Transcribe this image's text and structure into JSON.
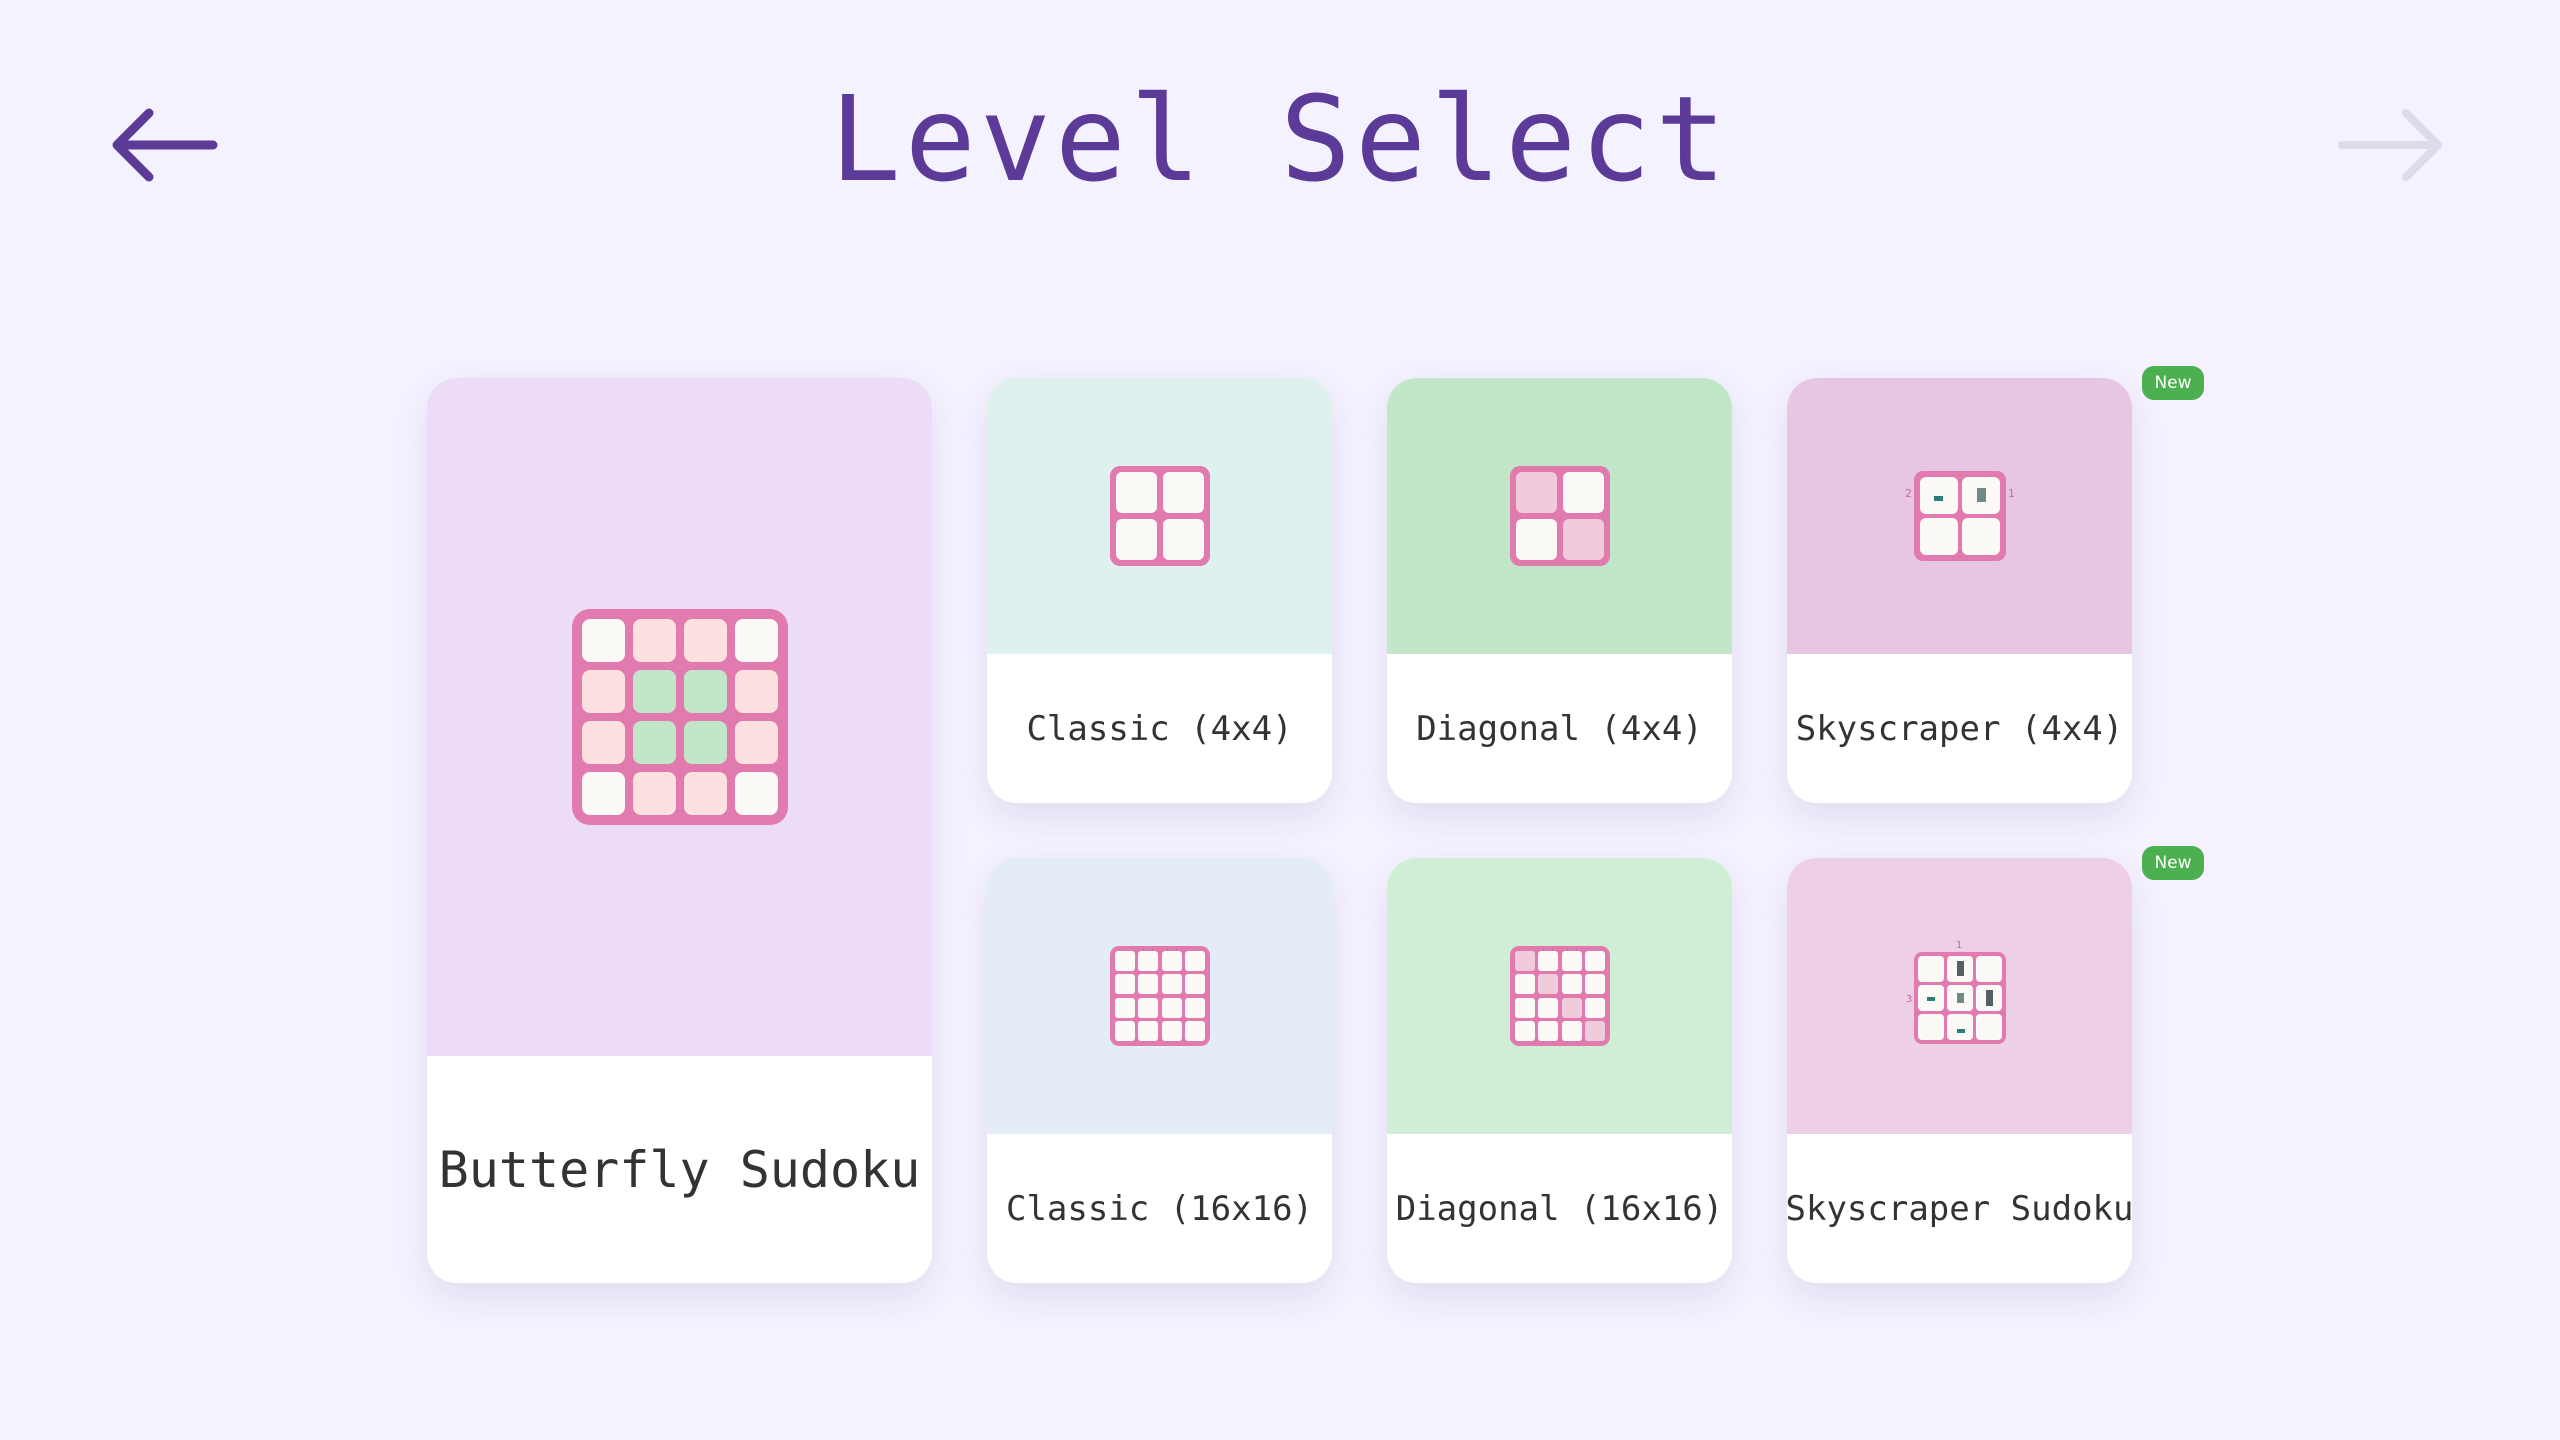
{
  "header": {
    "title": "Level Select",
    "back_icon": "arrow-left-icon",
    "forward_icon": "arrow-right-icon"
  },
  "colors": {
    "background": "#f4f2fe",
    "title": "#5c3a98",
    "forward_disabled": "#dddbe8",
    "grid_border": "#e07aaf",
    "badge": "#4caf50"
  },
  "levels": [
    {
      "label": "Butterfly Sudoku",
      "icon": "butterfly-grid-icon",
      "bg": "#ecdcf8"
    },
    {
      "label": "Classic (4x4)",
      "icon": "classic-4x4-grid-icon",
      "bg": "#dff1ee"
    },
    {
      "label": "Diagonal (4x4)",
      "icon": "diagonal-4x4-grid-icon",
      "bg": "#c1e7c8"
    },
    {
      "label": "Skyscraper (4x4)",
      "icon": "skyscraper-4x4-grid-icon",
      "bg": "#e6c6e3",
      "badge": "New",
      "clues": [
        "2",
        "1"
      ]
    },
    {
      "label": "Classic (16x16)",
      "icon": "classic-16x16-grid-icon",
      "bg": "#e4ecf7"
    },
    {
      "label": "Diagonal (16x16)",
      "icon": "diagonal-16x16-grid-icon",
      "bg": "#d0edd5"
    },
    {
      "label": "Skyscraper Sudoku",
      "icon": "skyscraper-sudoku-grid-icon",
      "bg": "#edcfe6",
      "badge": "New",
      "clues": [
        "1",
        "3"
      ]
    }
  ]
}
